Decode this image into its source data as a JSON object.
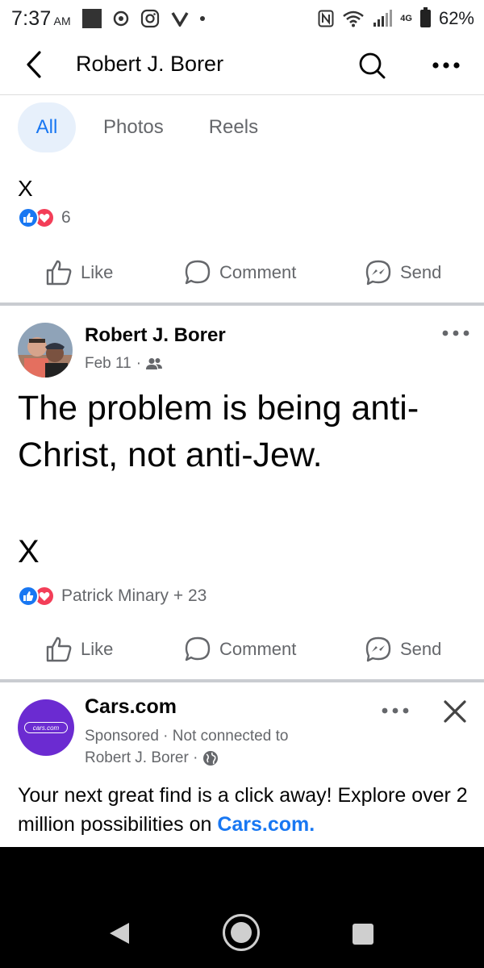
{
  "status_bar": {
    "time": "7:37",
    "ampm": "AM",
    "network": "4G",
    "battery": "62%"
  },
  "header": {
    "title": "Robert J. Borer"
  },
  "tabs": [
    {
      "label": "All",
      "active": true
    },
    {
      "label": "Photos",
      "active": false
    },
    {
      "label": "Reels",
      "active": false
    }
  ],
  "post1": {
    "text": "X",
    "reaction_count": "6"
  },
  "actions": {
    "like": "Like",
    "comment": "Comment",
    "send": "Send"
  },
  "post2": {
    "author": "Robert J. Borer",
    "date": "Feb 11",
    "separator": "·",
    "text": "The problem is being anti-Christ, not anti-Jew.",
    "x": "X",
    "reactions": "Patrick Minary + 23"
  },
  "ad": {
    "logo_text": "cars.com",
    "name": "Cars.com",
    "meta1": "Sponsored · Not connected to",
    "meta2": "Robert J. Borer ·",
    "text": "Your next great find is a click away! Explore over 2 million possibilities on ",
    "link": "Cars.com."
  },
  "colors": {
    "accent": "#1877f2",
    "love": "#f33e58",
    "secondary_text": "#65676b",
    "ad_logo": "#6b2bd1"
  }
}
